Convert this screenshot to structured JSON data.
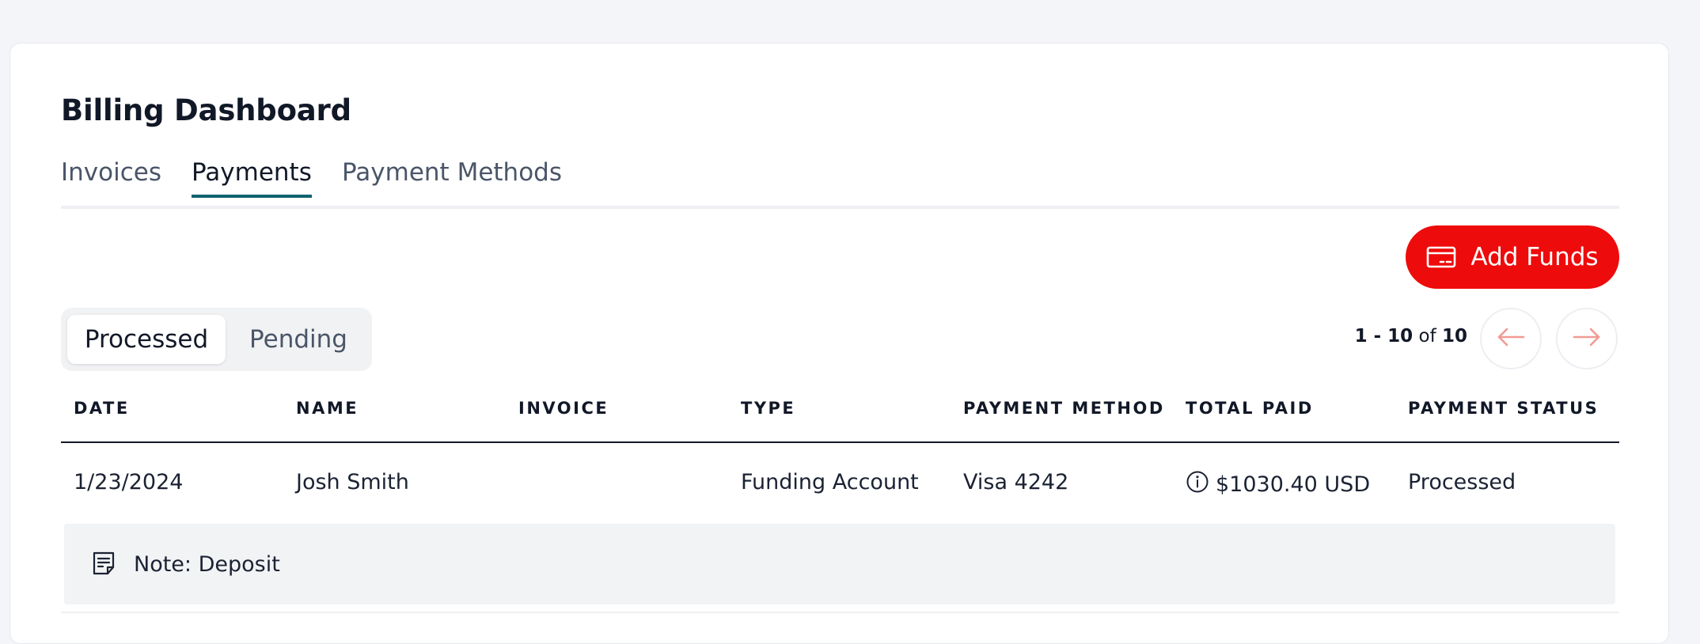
{
  "page": {
    "title": "Billing Dashboard"
  },
  "tabs": [
    {
      "label": "Invoices",
      "active": false
    },
    {
      "label": "Payments",
      "active": true
    },
    {
      "label": "Payment Methods",
      "active": false
    }
  ],
  "actions": {
    "add_funds_label": "Add Funds",
    "add_funds_icon": "credit-card-icon",
    "accent_color": "#ee0b0b"
  },
  "status_filter": {
    "options": [
      {
        "label": "Processed",
        "selected": true
      },
      {
        "label": "Pending",
        "selected": false
      }
    ]
  },
  "pagination": {
    "range_start": "1",
    "range_sep": " - ",
    "range_end": "10",
    "of_label": " of ",
    "total": "10",
    "prev_icon": "arrow-left-icon",
    "next_icon": "arrow-right-icon"
  },
  "table": {
    "columns": [
      "DATE",
      "NAME",
      "INVOICE",
      "TYPE",
      "PAYMENT METHOD",
      "TOTAL PAID",
      "PAYMENT STATUS"
    ],
    "rows": [
      {
        "date": "1/23/2024",
        "name": "Josh Smith",
        "invoice": "",
        "type": "Funding Account",
        "payment_method": "Visa 4242",
        "total_paid": "$1030.40 USD",
        "total_paid_icon": "info-icon",
        "status": "Processed",
        "note": "Note: Deposit",
        "note_icon": "note-icon"
      }
    ]
  },
  "colors": {
    "tab_underline": "#0f6370",
    "pager_arrow": "#f29a94"
  }
}
